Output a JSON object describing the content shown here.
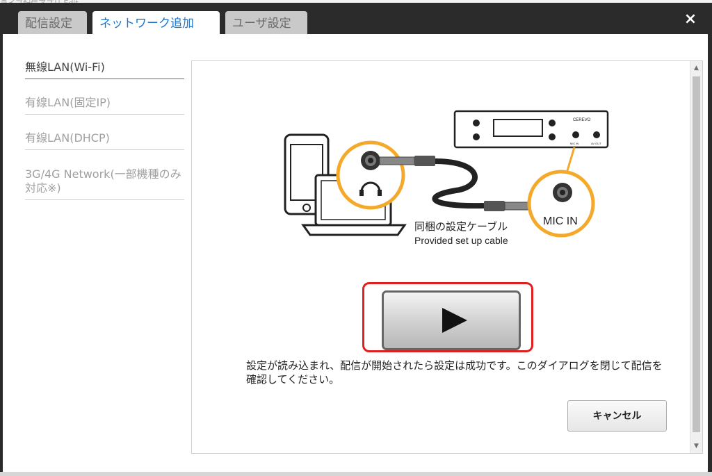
{
  "background": {
    "partial_text": "ライブ配信アプリ Edit"
  },
  "tabs": [
    {
      "label": "配信設定",
      "active": false
    },
    {
      "label": "ネットワーク追加",
      "active": true
    },
    {
      "label": "ユーザ設定",
      "active": false
    }
  ],
  "close_label": "×",
  "sidebar": {
    "items": [
      {
        "label": "無線LAN(Wi-Fi)",
        "active": true
      },
      {
        "label": "有線LAN(固定IP)",
        "active": false
      },
      {
        "label": "有線LAN(DHCP)",
        "active": false
      },
      {
        "label": "3G/4G Network(一部機種のみ対応※)",
        "active": false
      }
    ]
  },
  "illustration": {
    "brand": "CEREVO",
    "mic_in_small": "MIC IN",
    "av_out": "AV OUT",
    "mic_in_label": "MIC IN",
    "cable_label_ja": "同梱の設定ケーブル",
    "cable_label_en": "Provided set up cable"
  },
  "message": "設定が読み込まれ、配信が開始されたら設定は成功です。このダイアログを閉じて配信を確認してください。",
  "cancel_label": "キャンセル",
  "colors": {
    "accent": "#1b77c9",
    "highlight": "#e0201f",
    "orange": "#f4a92a",
    "dialog_bg": "#2b2b2b"
  }
}
